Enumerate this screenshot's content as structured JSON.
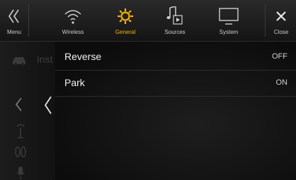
{
  "topbar": {
    "menu": {
      "label": "Menu",
      "icon": "double-chevron-left-icon"
    },
    "tabs": [
      {
        "label": "Wireless",
        "icon": "wifi-icon"
      },
      {
        "label": "General",
        "icon": "gear-icon",
        "active": true
      },
      {
        "label": "Sources",
        "icon": "music-note-icon"
      },
      {
        "label": "System",
        "icon": "monitor-icon"
      }
    ],
    "close": {
      "label": "Close",
      "icon": "close-icon"
    }
  },
  "background": {
    "ghost_label": "Inst"
  },
  "settings": {
    "rows": [
      {
        "label": "Reverse",
        "value": "OFF"
      },
      {
        "label": "Park",
        "value": "ON"
      }
    ]
  },
  "colors": {
    "accent": "#f5b400",
    "text": "#f2f2f2",
    "background": "#0e0e0e"
  }
}
